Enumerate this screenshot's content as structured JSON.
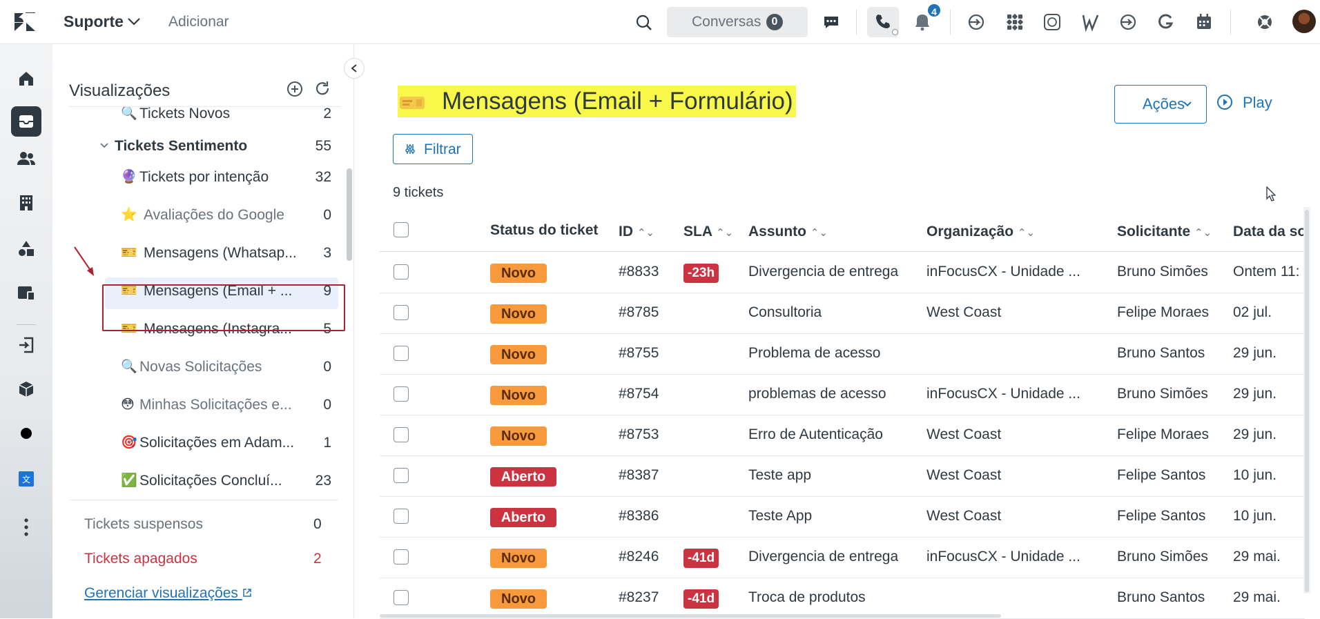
{
  "topbar": {
    "product": "Suporte",
    "add_label": "Adicionar",
    "conversations_label": "Conversas",
    "conversations_count": "0",
    "notifications_count": "4"
  },
  "views": {
    "title": "Visualizações",
    "items": [
      {
        "icon": "🔍",
        "name": "Tickets Novos",
        "count": "2"
      },
      {
        "name": "Tickets Sentimento",
        "count": "55"
      },
      {
        "icon": "🔮",
        "name": "Tickets por intenção",
        "count": "32"
      },
      {
        "icon": "⭐",
        "name": "Avaliações do Google",
        "count": "0"
      },
      {
        "icon": "🎫",
        "name": "Mensagens (Whatsap...",
        "count": "3"
      },
      {
        "icon": "🎫",
        "name": "Mensagens (Email + ...",
        "count": "9"
      },
      {
        "icon": "🎫",
        "name": "Mensagens (Instagra...",
        "count": "5"
      },
      {
        "icon": "🔍",
        "name": "Novas Solicitações",
        "count": "0"
      },
      {
        "icon": "😳",
        "name": "Minhas Solicitações e...",
        "count": "0"
      },
      {
        "icon": "🎯",
        "name": "Solicitações em Adam...",
        "count": "1"
      },
      {
        "icon": "✅",
        "name": "Solicitações Concluí...",
        "count": "23"
      }
    ],
    "suspended_label": "Tickets suspensos",
    "suspended_count": "0",
    "deleted_label": "Tickets apagados",
    "deleted_count": "2",
    "manage_label": "Gerenciar visualizações"
  },
  "main": {
    "title": "Mensagens (Email + Formulário)",
    "actions_label": "Ações",
    "play_label": "Play",
    "filter_label": "Filtrar",
    "ticket_count": "9 tickets",
    "columns": [
      "Status do ticket",
      "ID",
      "SLA",
      "Assunto",
      "Organização",
      "Solicitante",
      "Data da so"
    ],
    "rows": [
      {
        "status": "Novo",
        "id": "#8833",
        "sla": "-23h",
        "subject": "Divergencia de entrega",
        "org": "inFocusCX - Unidade ...",
        "requester": "Bruno Simões",
        "date": "Ontem 11:"
      },
      {
        "status": "Novo",
        "id": "#8785",
        "sla": "",
        "subject": "Consultoria",
        "org": "West Coast",
        "requester": "Felipe Moraes",
        "date": "02 jul."
      },
      {
        "status": "Novo",
        "id": "#8755",
        "sla": "",
        "subject": "Problema de acesso",
        "org": "",
        "requester": "Bruno Santos",
        "date": "29 jun."
      },
      {
        "status": "Novo",
        "id": "#8754",
        "sla": "",
        "subject": "problemas de acesso",
        "org": "inFocusCX - Unidade ...",
        "requester": "Bruno Simões",
        "date": "29 jun."
      },
      {
        "status": "Novo",
        "id": "#8753",
        "sla": "",
        "subject": "Erro de Autenticação",
        "org": "West Coast",
        "requester": "Felipe Moraes",
        "date": "29 jun."
      },
      {
        "status": "Aberto",
        "id": "#8387",
        "sla": "",
        "subject": "Teste app",
        "org": "West Coast",
        "requester": "Felipe Santos",
        "date": "10 jun."
      },
      {
        "status": "Aberto",
        "id": "#8386",
        "sla": "",
        "subject": "Teste App",
        "org": "West Coast",
        "requester": "Felipe Santos",
        "date": "10 jun."
      },
      {
        "status": "Novo",
        "id": "#8246",
        "sla": "-41d",
        "subject": "Divergencia de entrega",
        "org": "inFocusCX - Unidade ...",
        "requester": "Bruno Simões",
        "date": "29 mai."
      },
      {
        "status": "Novo",
        "id": "#8237",
        "sla": "-41d",
        "subject": "Troca de produtos",
        "org": "",
        "requester": "Bruno Santos",
        "date": "29 mai."
      }
    ]
  },
  "colors": {
    "accent": "#1f73b7",
    "highlight": "#f8f84a",
    "status_novo": "#f79a3e",
    "status_aberto": "#cc3340",
    "sla_breach": "#cc3340",
    "selection_box": "#b01f2d"
  }
}
